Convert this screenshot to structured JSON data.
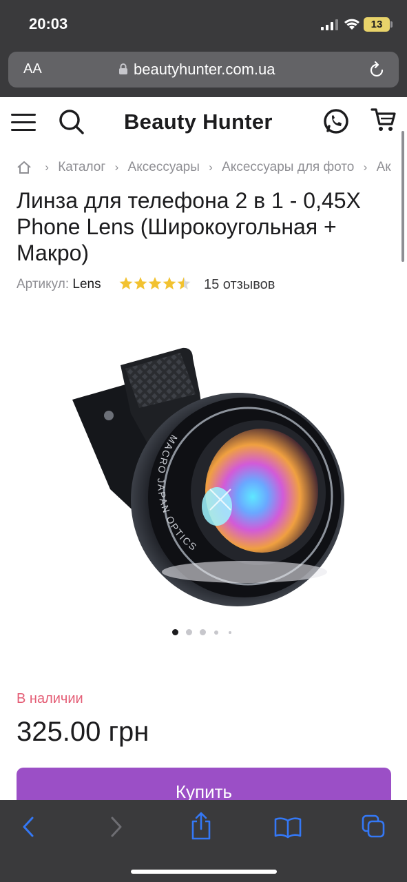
{
  "status_bar": {
    "time": "20:03",
    "battery_level": "13"
  },
  "browser": {
    "text_size_label": "AA",
    "url": "beautyhunter.com.ua"
  },
  "header": {
    "site_name": "Beauty Hunter"
  },
  "breadcrumb": {
    "items": [
      "Каталог",
      "Аксессуары",
      "Аксессуары для фото",
      "Ак"
    ]
  },
  "product": {
    "title": "Линза для телефона 2 в 1 - 0,45X Phone Lens (Широкоугольная + Макро)",
    "sku_label": "Артикул:",
    "sku_value": "Lens",
    "rating": 4.5,
    "reviews_text": "15 отзывов",
    "lens_engraving": "MACRO JAPAN OPTICS",
    "image_count": 5,
    "active_image": 1,
    "stock_status": "В наличии",
    "price": "325.00 грн",
    "buy_label": "Купить"
  },
  "colors": {
    "accent": "#9b4fc6",
    "stock": "#e45d75",
    "star": "#f2c230",
    "toolbar_icon": "#3478f6"
  }
}
